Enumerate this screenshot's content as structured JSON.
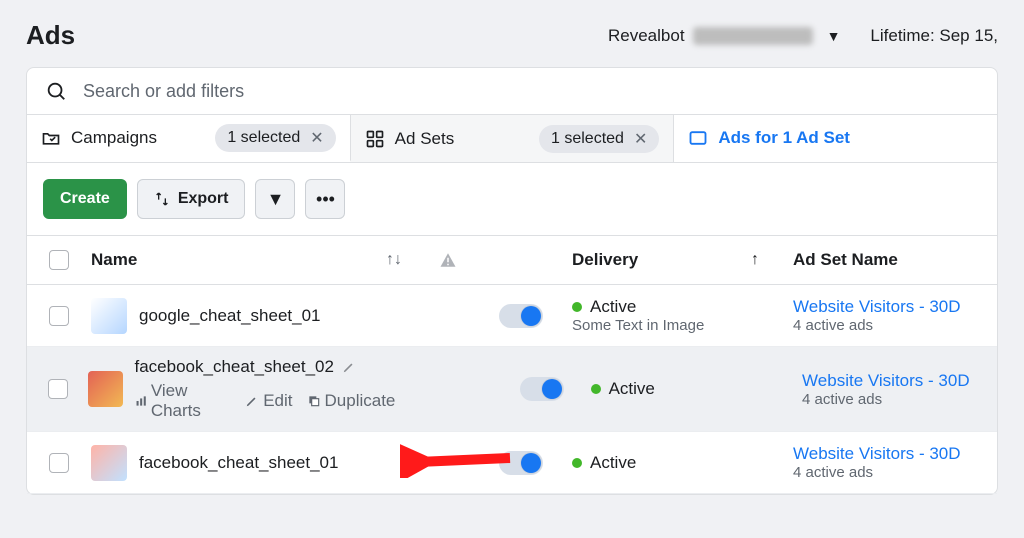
{
  "header": {
    "title": "Ads",
    "account_label": "Revealbot",
    "date_range": "Lifetime: Sep 15,"
  },
  "search": {
    "placeholder": "Search or add filters"
  },
  "tabs": {
    "campaigns": {
      "label": "Campaigns",
      "chip": "1 selected"
    },
    "adsets": {
      "label": "Ad Sets",
      "chip": "1 selected"
    },
    "ads": {
      "label": "Ads for 1 Ad Set"
    }
  },
  "toolbar": {
    "create": "Create",
    "export": "Export"
  },
  "columns": {
    "name": "Name",
    "delivery": "Delivery",
    "adset": "Ad Set Name"
  },
  "actions": {
    "view_charts": "View Charts",
    "edit": "Edit",
    "duplicate": "Duplicate"
  },
  "rows": [
    {
      "name": "google_cheat_sheet_01",
      "delivery": "Active",
      "delivery_sub": "Some Text in Image",
      "adset": "Website Visitors - 30D",
      "adset_sub": "4 active ads",
      "hovered": false,
      "thumb": "g"
    },
    {
      "name": "facebook_cheat_sheet_02",
      "delivery": "Active",
      "delivery_sub": "",
      "adset": "Website Visitors - 30D",
      "adset_sub": "4 active ads",
      "hovered": true,
      "thumb": "f"
    },
    {
      "name": "facebook_cheat_sheet_01",
      "delivery": "Active",
      "delivery_sub": "",
      "adset": "Website Visitors - 30D",
      "adset_sub": "4 active ads",
      "hovered": false,
      "thumb": "f1"
    }
  ]
}
